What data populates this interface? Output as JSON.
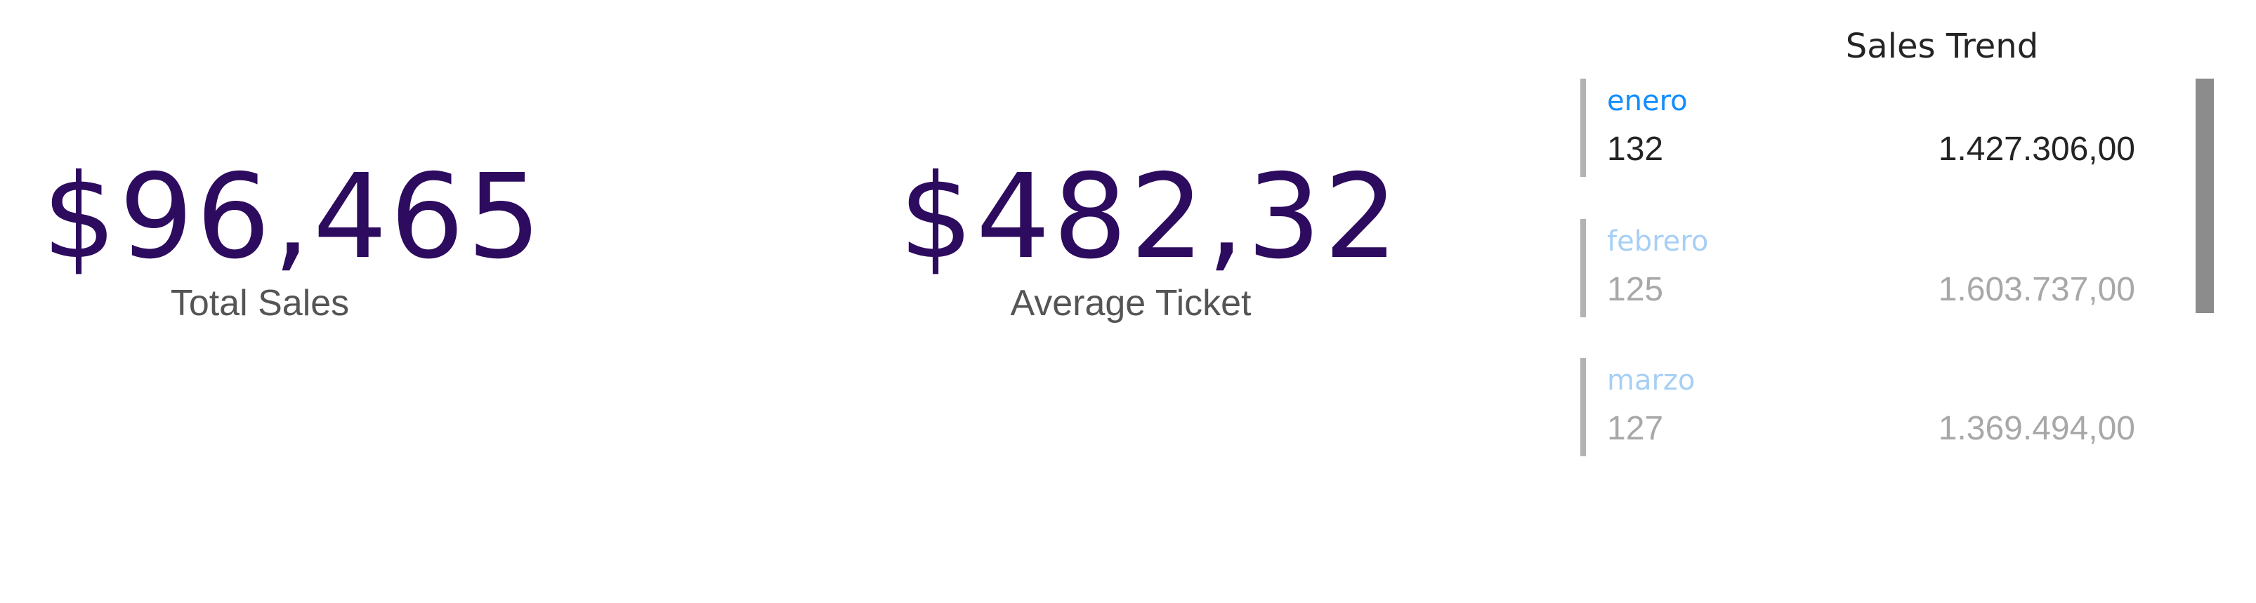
{
  "kpis": {
    "total_sales": {
      "value": "$96,465",
      "label": "Total Sales"
    },
    "average_ticket": {
      "value": "$482,32",
      "label": "Average Ticket"
    }
  },
  "sales_trend": {
    "title": "Sales Trend",
    "items": [
      {
        "month": "enero",
        "count": "132",
        "amount": "1.427.306,00"
      },
      {
        "month": "febrero",
        "count": "125",
        "amount": "1.603.737,00"
      },
      {
        "month": "marzo",
        "count": "127",
        "amount": "1.369.494,00"
      }
    ]
  },
  "colors": {
    "kpi_value": "#2d0b5e",
    "kpi_label": "#555555",
    "selected_month": "#118dff",
    "dim_month": "#a6cff5",
    "dim_text": "#a8a8a8",
    "card_border": "#b3b3b3",
    "scrollbar": "#8c8c8c"
  }
}
